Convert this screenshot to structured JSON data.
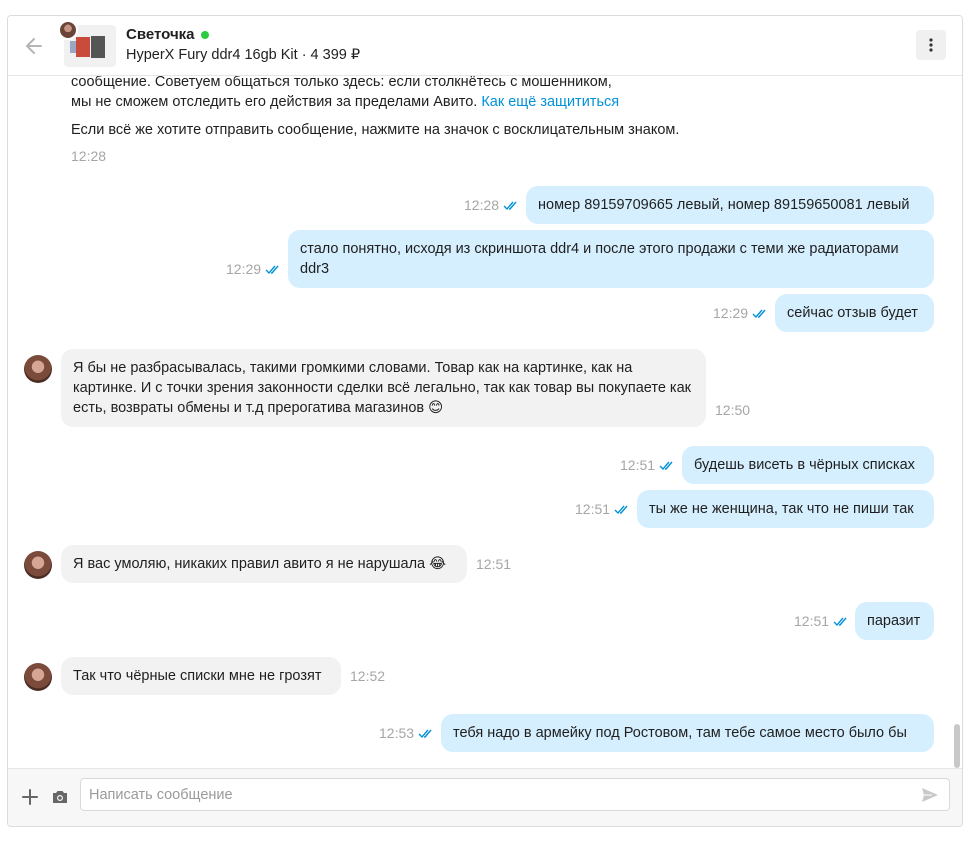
{
  "header": {
    "seller_name": "Светочка",
    "product_line": "HyperX Fury ddr4 16gb Kit · 4 399 ₽"
  },
  "system_message": {
    "line1": "сообщение. Советуем общаться только здесь: если столкнётесь с мошенником,",
    "line2_text": "мы не сможем отследить его действия за пределами Авито.",
    "line2_link": "Как ещё защититься",
    "line3": "Если всё же хотите отправить сообщение, нажмите на значок с восклицательным знаком.",
    "time": "12:28"
  },
  "messages": [
    {
      "dir": "out",
      "text": "номер 89159709665 левый, номер 89159650081 левый",
      "time": "12:28"
    },
    {
      "dir": "out",
      "text": "стало понятно, исходя из скриншота ddr4 и после этого продажи с теми же радиаторами ddr3",
      "time": "12:29"
    },
    {
      "dir": "out",
      "text": "сейчас отзыв будет",
      "time": "12:29"
    },
    {
      "dir": "in",
      "text": "Я бы не разбрасывалась, такими громкими словами. Товар как на картинке, как на картинке. И с точки зрения законности сделки всё легально, так как товар вы покупаете как есть, возвраты обмены и т.д прерогатива магазинов 😊",
      "time": "12:50"
    },
    {
      "dir": "out",
      "text": "будешь висеть в чёрных списках",
      "time": "12:51"
    },
    {
      "dir": "out",
      "text": "ты же не женщина, так что не пиши так",
      "time": "12:51"
    },
    {
      "dir": "in",
      "text": "Я вас умоляю, никаких правил авито я не нарушала 😂",
      "time": "12:51"
    },
    {
      "dir": "out",
      "text": "паразит",
      "time": "12:51"
    },
    {
      "dir": "in",
      "text": "Так что чёрные списки мне не грозят",
      "time": "12:52"
    },
    {
      "dir": "out",
      "text": "тебя надо в армейку под Ростовом, там тебе самое место было бы",
      "time": "12:53"
    }
  ],
  "composer": {
    "placeholder": "Написать сообщение"
  },
  "colors": {
    "outgoing_bubble": "#d5efff",
    "incoming_bubble": "#f2f2f2",
    "online": "#2bcc3f",
    "link": "#0091d9",
    "read_ticks": "#0091d9"
  },
  "icons": [
    "back-arrow-icon",
    "kebab-menu-icon",
    "double-check-icon",
    "plus-icon",
    "camera-icon",
    "send-icon"
  ]
}
